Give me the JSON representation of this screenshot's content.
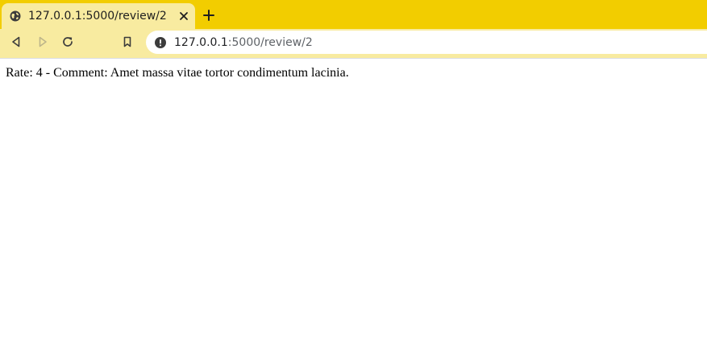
{
  "tab": {
    "title": "127.0.0.1:5000/review/2"
  },
  "address_bar": {
    "host": "127.0.0.1",
    "path": ":5000/review/2"
  },
  "review": {
    "rate_label": "Rate:",
    "rate_value": "4",
    "separator": " - ",
    "comment_label": "Comment:",
    "comment_text": "Amet massa vitae tortor condimentum lacinia."
  },
  "colors": {
    "tabstrip": "#f2cd00",
    "toolbar": "#f8eba0"
  },
  "icons": {
    "tab_favicon": "globe-icon",
    "tab_close": "close-icon",
    "new_tab": "plus-icon",
    "back": "back-arrow-icon",
    "forward": "forward-arrow-icon",
    "reload": "reload-icon",
    "bookmark": "bookmark-icon",
    "site_info": "info-warning-icon"
  }
}
